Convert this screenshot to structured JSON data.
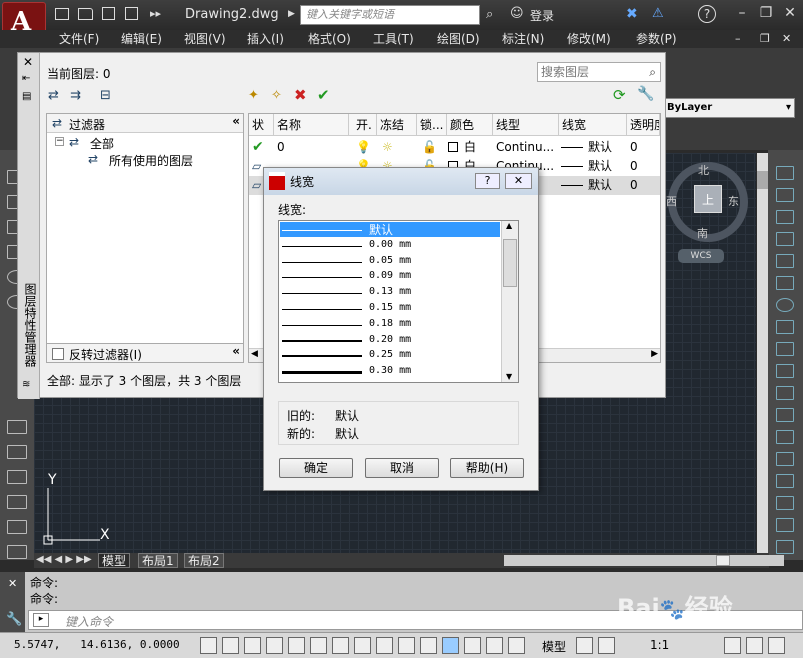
{
  "app": {
    "doc_title": "Drawing2.dwg",
    "search_placeholder": "键入关键字或短语",
    "login": "登录",
    "help": "?"
  },
  "menu": [
    "文件(F)",
    "编辑(E)",
    "视图(V)",
    "插入(I)",
    "格式(O)",
    "工具(T)",
    "绘图(D)",
    "标注(N)",
    "修改(M)",
    "参数(P)"
  ],
  "properties": {
    "linetype": "ByLayer"
  },
  "viewcube": {
    "north": "北",
    "south": "南",
    "east": "东",
    "west": "西",
    "top": "上",
    "wcs": "WCS"
  },
  "layer_manager": {
    "current_layer": "当前图层: 0",
    "search_placeholder": "搜索图层",
    "side_title": "图层特性管理器",
    "filter_header": "过滤器",
    "tree_all": "全部",
    "tree_used": "所有使用的图层",
    "invert_filter": "反转过滤器(I)",
    "columns": [
      "状",
      "名称",
      "开.",
      "冻结",
      "锁...",
      "颜色",
      "线型",
      "线宽",
      "透明度"
    ],
    "rows": [
      {
        "name": "0",
        "color": "白",
        "linetype": "Continu...",
        "lineweight": "默认",
        "transparency": "0"
      },
      {
        "name": "...",
        "color": "白",
        "linetype": "Continu...",
        "lineweight": "默认",
        "transparency": "0"
      },
      {
        "name": "",
        "color": "",
        "linetype": "",
        "lineweight": "默认",
        "transparency": "0"
      }
    ],
    "status": "全部: 显示了 3 个图层，共 3 个图层"
  },
  "dialog": {
    "title": "线宽",
    "label": "线宽:",
    "items": [
      {
        "label": "默认",
        "weight": 1
      },
      {
        "label": "0.00 mm",
        "weight": 1
      },
      {
        "label": "0.05 mm",
        "weight": 1
      },
      {
        "label": "0.09 mm",
        "weight": 1
      },
      {
        "label": "0.13 mm",
        "weight": 1
      },
      {
        "label": "0.15 mm",
        "weight": 1
      },
      {
        "label": "0.18 mm",
        "weight": 1
      },
      {
        "label": "0.20 mm",
        "weight": 2
      },
      {
        "label": "0.25 mm",
        "weight": 2
      },
      {
        "label": "0.30 mm",
        "weight": 3
      }
    ],
    "old_label": "旧的:",
    "old_value": "默认",
    "new_label": "新的:",
    "new_value": "默认",
    "ok": "确定",
    "cancel": "取消",
    "help": "帮助(H)"
  },
  "tabs": [
    "模型",
    "布局1",
    "布局2"
  ],
  "command": {
    "line1": "命令:",
    "line2": "命令:",
    "input_placeholder": "键入命令"
  },
  "status": {
    "coords": "5.5747,   14.6136, 0.0000",
    "model": "模型",
    "scale": "1:1"
  }
}
